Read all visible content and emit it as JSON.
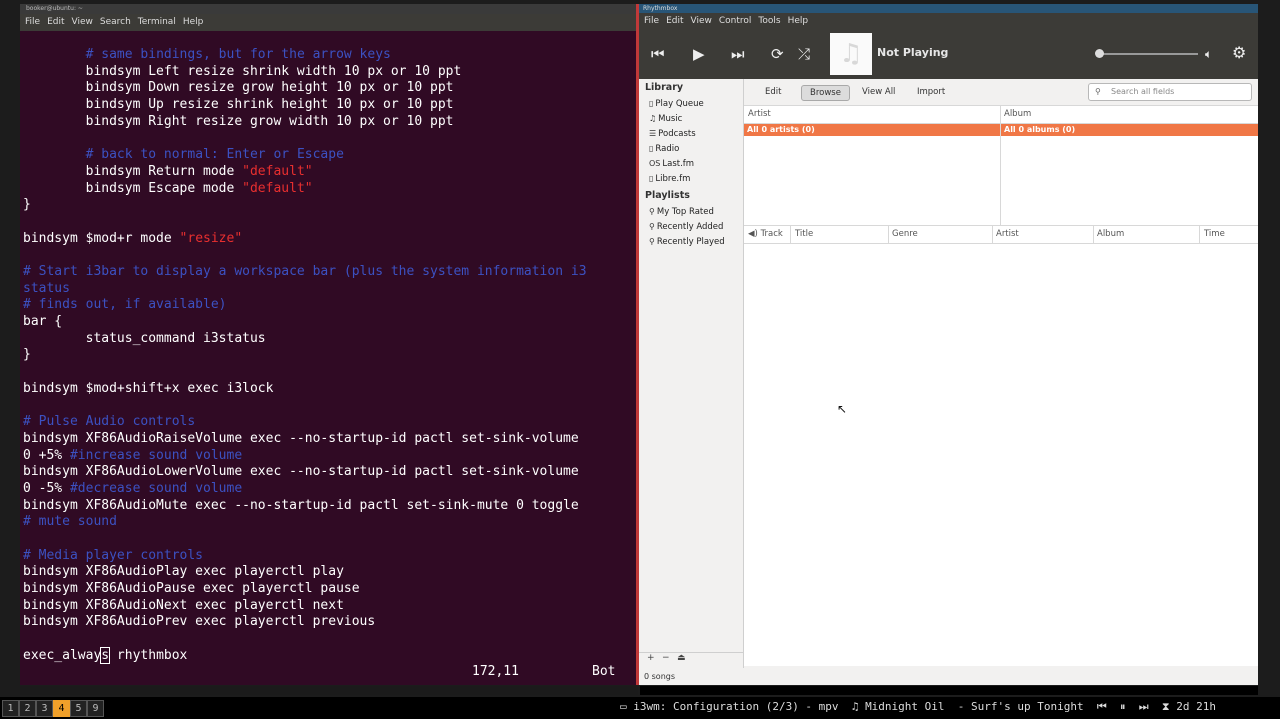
{
  "terminal": {
    "title": "booker@ubuntu: ~",
    "menu": [
      "File",
      "Edit",
      "View",
      "Search",
      "Terminal",
      "Help"
    ],
    "lines": [
      [
        {
          "t": "        "
        },
        {
          "t": "# same bindings, but for the arrow keys",
          "c": "cm"
        }
      ],
      [
        {
          "t": "        bindsym Left resize shrink width 10 px or 10 ppt"
        }
      ],
      [
        {
          "t": "        bindsym Down resize grow height 10 px or 10 ppt"
        }
      ],
      [
        {
          "t": "        bindsym Up resize shrink height 10 px or 10 ppt"
        }
      ],
      [
        {
          "t": "        bindsym Right resize grow width 10 px or 10 ppt"
        }
      ],
      [
        {
          "t": ""
        }
      ],
      [
        {
          "t": "        "
        },
        {
          "t": "# back to normal: Enter or Escape",
          "c": "cm"
        }
      ],
      [
        {
          "t": "        bindsym Return mode "
        },
        {
          "t": "\"default\"",
          "c": "st"
        }
      ],
      [
        {
          "t": "        bindsym Escape mode "
        },
        {
          "t": "\"default\"",
          "c": "st"
        }
      ],
      [
        {
          "t": "}"
        }
      ],
      [
        {
          "t": ""
        }
      ],
      [
        {
          "t": "bindsym $mod+r mode "
        },
        {
          "t": "\"resize\"",
          "c": "st"
        }
      ],
      [
        {
          "t": ""
        }
      ],
      [
        {
          "t": "# Start i3bar to display a workspace bar (plus the system information i3",
          "c": "cm"
        }
      ],
      [
        {
          "t": "status",
          "c": "cm"
        }
      ],
      [
        {
          "t": "# finds out, if available)",
          "c": "cm"
        }
      ],
      [
        {
          "t": "bar {"
        }
      ],
      [
        {
          "t": "        status_command i3status"
        }
      ],
      [
        {
          "t": "}"
        }
      ],
      [
        {
          "t": ""
        }
      ],
      [
        {
          "t": "bindsym $mod+shift+x exec i3lock"
        }
      ],
      [
        {
          "t": ""
        }
      ],
      [
        {
          "t": "# Pulse Audio controls",
          "c": "cm"
        }
      ],
      [
        {
          "t": "bindsym XF86AudioRaiseVolume exec --no-startup-id pactl set-sink-volume"
        }
      ],
      [
        {
          "t": "0 +5% "
        },
        {
          "t": "#increase sound volume",
          "c": "cm"
        }
      ],
      [
        {
          "t": "bindsym XF86AudioLowerVolume exec --no-startup-id pactl set-sink-volume"
        }
      ],
      [
        {
          "t": "0 -5% "
        },
        {
          "t": "#decrease sound volume",
          "c": "cm"
        }
      ],
      [
        {
          "t": "bindsym XF86AudioMute exec --no-startup-id pactl set-sink-mute 0 toggle"
        }
      ],
      [
        {
          "t": "# mute sound",
          "c": "cm"
        }
      ],
      [
        {
          "t": ""
        }
      ],
      [
        {
          "t": "# Media player controls",
          "c": "cm"
        }
      ],
      [
        {
          "t": "bindsym XF86AudioPlay exec playerctl play"
        }
      ],
      [
        {
          "t": "bindsym XF86AudioPause exec playerctl pause"
        }
      ],
      [
        {
          "t": "bindsym XF86AudioNext exec playerctl next"
        }
      ],
      [
        {
          "t": "bindsym XF86AudioPrev exec playerctl previous"
        }
      ],
      [
        {
          "t": ""
        }
      ],
      [
        {
          "t": "exec_alway"
        },
        {
          "t": "s",
          "c": "cursor"
        },
        {
          "t": " rhythmbox"
        }
      ]
    ],
    "position": "172,11",
    "scroll": "Bot"
  },
  "rhythmbox": {
    "title": "Rhythmbox",
    "menu": [
      "File",
      "Edit",
      "View",
      "Control",
      "Tools",
      "Help"
    ],
    "now_playing": "Not Playing",
    "icons": {
      "prev": "previous-icon",
      "play": "play-icon",
      "next": "next-icon",
      "repeat": "repeat-icon",
      "shuffle": "shuffle-icon",
      "volume": "volume-icon",
      "settings": "gear-icon",
      "art": "music-note-icon"
    },
    "sidebar": {
      "library_heading": "Library",
      "library": [
        {
          "label": "Play Queue",
          "icon": "▯"
        },
        {
          "label": "Music",
          "icon": "♫"
        },
        {
          "label": "Podcasts",
          "icon": "☰"
        },
        {
          "label": "Radio",
          "icon": "▯"
        },
        {
          "label": "Last.fm",
          "icon": "OS"
        },
        {
          "label": "Libre.fm",
          "icon": "▯"
        }
      ],
      "playlists_heading": "Playlists",
      "playlists": [
        {
          "label": "My Top Rated",
          "icon": "⚲"
        },
        {
          "label": "Recently Added",
          "icon": "⚲"
        },
        {
          "label": "Recently Played",
          "icon": "⚲"
        }
      ],
      "footer": [
        "+",
        "−",
        "⏏"
      ]
    },
    "tabs": [
      "Edit",
      "Browse",
      "View All",
      "Import"
    ],
    "active_tab": "Browse",
    "search_placeholder": "Search all fields",
    "browser": {
      "artist_header": "Artist",
      "album_header": "Album",
      "artist_selected": "All 0 artists (0)",
      "album_selected": "All 0 albums (0)"
    },
    "track_columns": [
      "Track",
      "Title",
      "Genre",
      "Artist",
      "Album",
      "Time"
    ],
    "status": "0 songs"
  },
  "i3bar": {
    "workspaces": [
      "1",
      "2",
      "3",
      "4",
      "5",
      "9"
    ],
    "active_workspace": "4",
    "window_title": "i3wm: Configuration (2/3) - mpv",
    "track_text": "Midnight Oil  - Surf's up Tonight",
    "time_text": "2d 21h"
  },
  "colors": {
    "terminal_bg": "#300a24",
    "comment": "#3c51c2",
    "string": "#e82f2f",
    "selection": "#f07746",
    "workspace_active": "#f0a02a"
  }
}
